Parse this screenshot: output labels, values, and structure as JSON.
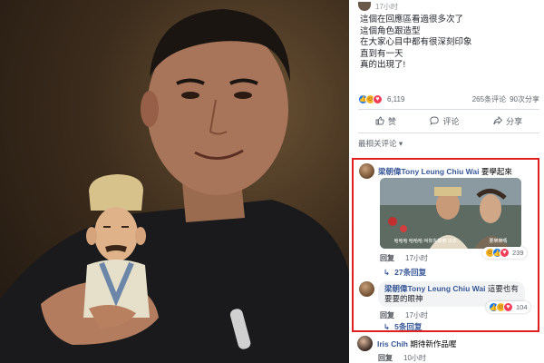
{
  "post": {
    "time": "17小时",
    "text_lines": [
      "這個在回應區看過很多次了",
      "這個角色跟造型",
      "在大家心目中都有很深刻印象",
      "直到有一天",
      "真的出現了!"
    ],
    "reaction_count": "6,119",
    "comment_count": "265条评论",
    "share_count": "90次分享",
    "actions": {
      "like": "赞",
      "comment": "评论",
      "share": "分享"
    },
    "sort_label": "最相关评论"
  },
  "comments": [
    {
      "author": "梁朝偉Tony Leung Chiu Wai",
      "text": "要學起來",
      "still_captions": [
        "哈哈哈 哈哈哈 叫你先擦擦 出去...",
        "要樂樂嗎"
      ],
      "reply_label": "回复",
      "time": "17小时",
      "reaction_count": "239",
      "replies_label": "27条回复"
    },
    {
      "author": "梁朝偉Tony Leung Chiu Wai",
      "text_line1": "這要也有",
      "text_line2": "要要的眼神",
      "reply_label": "回复",
      "time": "17小时",
      "reaction_count": "104",
      "replies_label": "5条回复"
    },
    {
      "author": "Iris Chih",
      "text": "期待新作品喔",
      "reply_label": "回复",
      "time": "10小时"
    }
  ],
  "icons": [
    "like-icon",
    "haha-icon",
    "love-icon",
    "thumb-icon",
    "comment-icon",
    "share-icon",
    "reply-arrow-icon"
  ],
  "colors": {
    "highlight": "#e02020",
    "link": "#385898",
    "like": "#1877f2",
    "love": "#f33e58",
    "haha": "#f7b125"
  }
}
